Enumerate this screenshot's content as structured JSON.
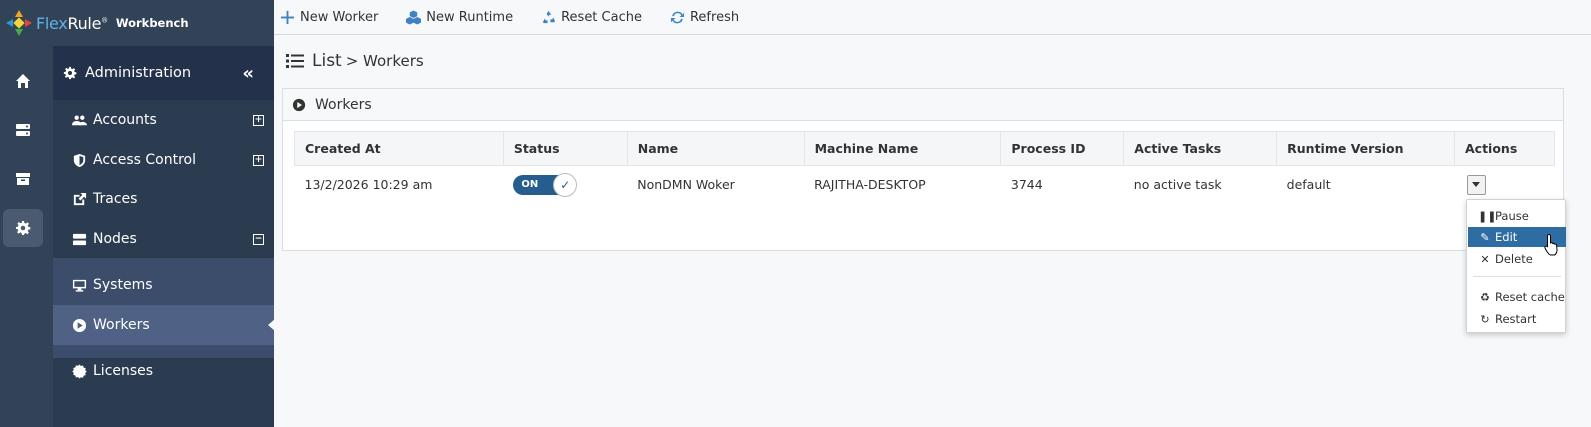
{
  "app": {
    "brand_flex": "Flex",
    "brand_rule": "Rule",
    "brand_reg": "®",
    "product": "Workbench",
    "accent": "#3d82c3"
  },
  "rail": {
    "icons": [
      "home-icon",
      "server-icon",
      "archive-icon",
      "gear-icon"
    ],
    "active": "gear-icon"
  },
  "sidebar": {
    "header": "Administration",
    "items": [
      {
        "label": "Accounts",
        "icon": "users-icon",
        "expander": "+"
      },
      {
        "label": "Access Control",
        "icon": "shield-icon",
        "expander": "+"
      },
      {
        "label": "Traces",
        "icon": "external-link-icon"
      },
      {
        "label": "Nodes",
        "icon": "server-icon",
        "expander": "−"
      },
      {
        "label": "Systems",
        "icon": "desktop-icon"
      },
      {
        "label": "Workers",
        "icon": "play-circle-icon",
        "active": true
      },
      {
        "label": "Licenses",
        "icon": "certificate-icon"
      }
    ]
  },
  "toolbar": {
    "new_worker": "New Worker",
    "new_runtime": "New Runtime",
    "reset_cache": "Reset Cache",
    "refresh": "Refresh"
  },
  "page": {
    "title": "List",
    "breadcrumb": "> Workers",
    "panel_title": "Workers"
  },
  "table": {
    "columns": [
      "Created At",
      "Status",
      "Name",
      "Machine Name",
      "Process ID",
      "Active Tasks",
      "Runtime Version",
      "Actions"
    ],
    "rows": [
      {
        "created_at": "13/2/2026 10:29 am",
        "status": "ON",
        "name": "NonDMN Woker",
        "machine_name": "RAJITHA-DESKTOP",
        "process_id": "3744",
        "active_tasks": "no active task",
        "runtime_version": "default"
      }
    ]
  },
  "actions_menu": {
    "items": [
      {
        "label": "Pause",
        "icon": "pause-icon"
      },
      {
        "label": "Edit",
        "icon": "pencil-icon",
        "highlighted": true
      },
      {
        "label": "Delete",
        "icon": "close-icon"
      },
      {
        "label": "Reset cache",
        "icon": "recycle-icon"
      },
      {
        "label": "Restart",
        "icon": "redo-icon"
      }
    ]
  }
}
